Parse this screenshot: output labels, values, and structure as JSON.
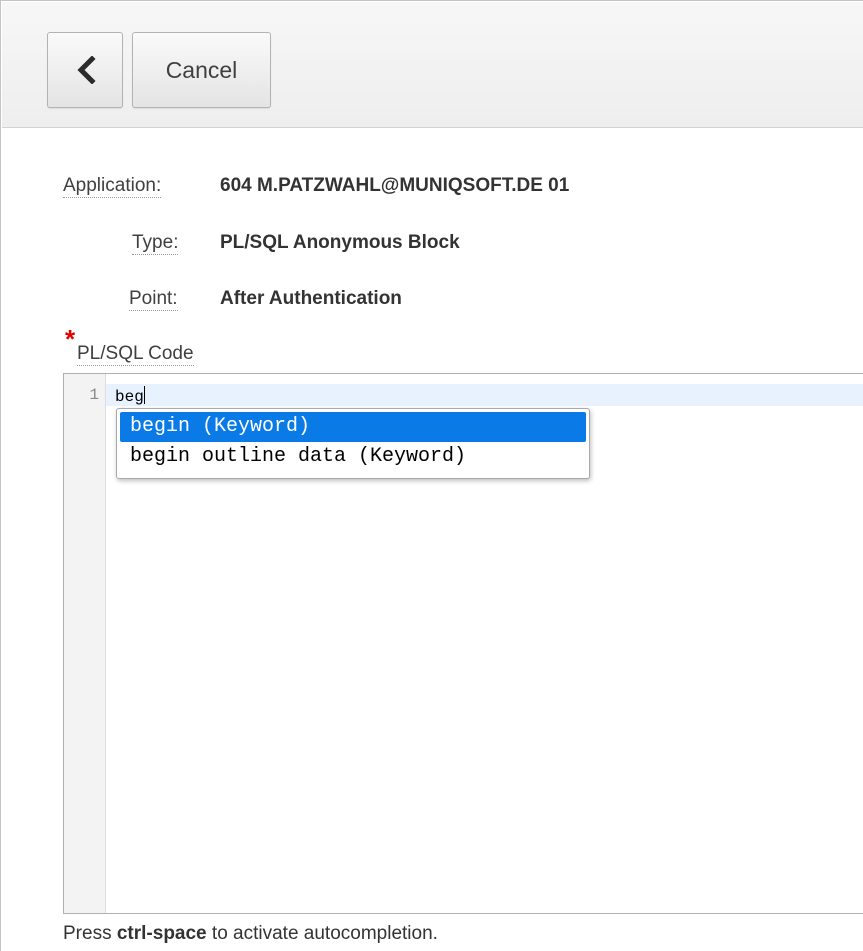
{
  "toolbar": {
    "back_icon": "chevron-left-icon",
    "cancel_label": "Cancel"
  },
  "fields": [
    {
      "label": "Application:",
      "value": "604 M.PATZWAHL@MUNIQSOFT.DE 01"
    },
    {
      "label": "Type:",
      "value": "PL/SQL Anonymous Block"
    },
    {
      "label": "Point:",
      "value": "After Authentication"
    }
  ],
  "code": {
    "required_marker": "*",
    "label": "PL/SQL Code",
    "line_number": "1",
    "text": "beg"
  },
  "autocomplete": {
    "items": [
      {
        "label": "begin (Keyword)",
        "selected": true
      },
      {
        "label": "begin outline data (Keyword)",
        "selected": false
      }
    ]
  },
  "hint": {
    "prefix": "Press ",
    "shortcut": "ctrl-space",
    "suffix": " to activate autocompletion."
  },
  "colors": {
    "selection": "#0a7ae6",
    "required": "#e60000",
    "active_line": "#e8f2fe"
  }
}
